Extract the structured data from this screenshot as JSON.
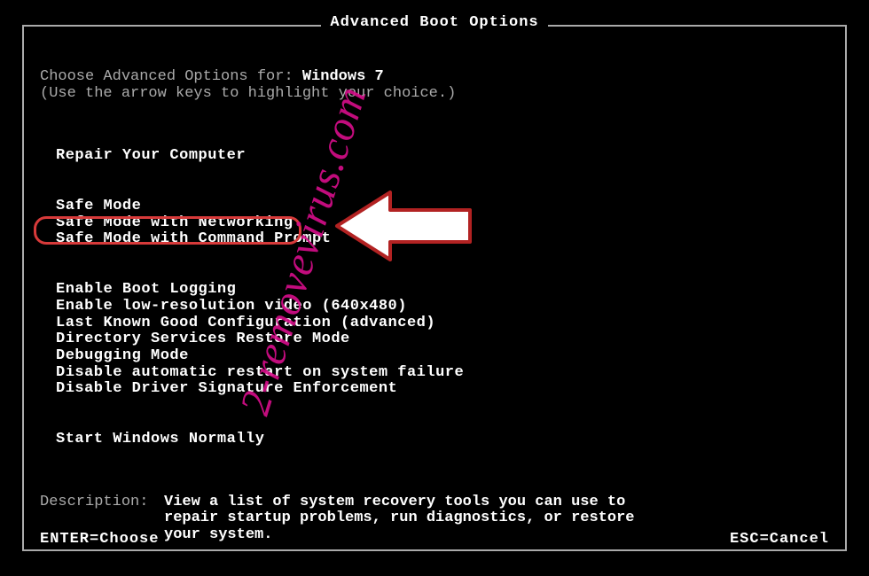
{
  "title": "Advanced Boot Options",
  "choose_prefix": "Choose Advanced Options for: ",
  "os_name": "Windows 7",
  "arrow_hint": "(Use the arrow keys to highlight your choice.)",
  "menu": {
    "group1": [
      "Repair Your Computer"
    ],
    "group2": [
      "Safe Mode",
      "Safe Mode with Networking",
      "Safe Mode with Command Prompt"
    ],
    "group3": [
      "Enable Boot Logging",
      "Enable low-resolution video (640x480)",
      "Last Known Good Configuration (advanced)",
      "Directory Services Restore Mode",
      "Debugging Mode",
      "Disable automatic restart on system failure",
      "Disable Driver Signature Enforcement"
    ],
    "group4": [
      "Start Windows Normally"
    ]
  },
  "description": {
    "label": "Description:",
    "text": "View a list of system recovery tools you can use to repair startup problems, run diagnostics, or restore your system."
  },
  "footer": {
    "enter": "ENTER=Choose",
    "esc": "ESC=Cancel"
  },
  "watermark": "2-removevirus.com"
}
